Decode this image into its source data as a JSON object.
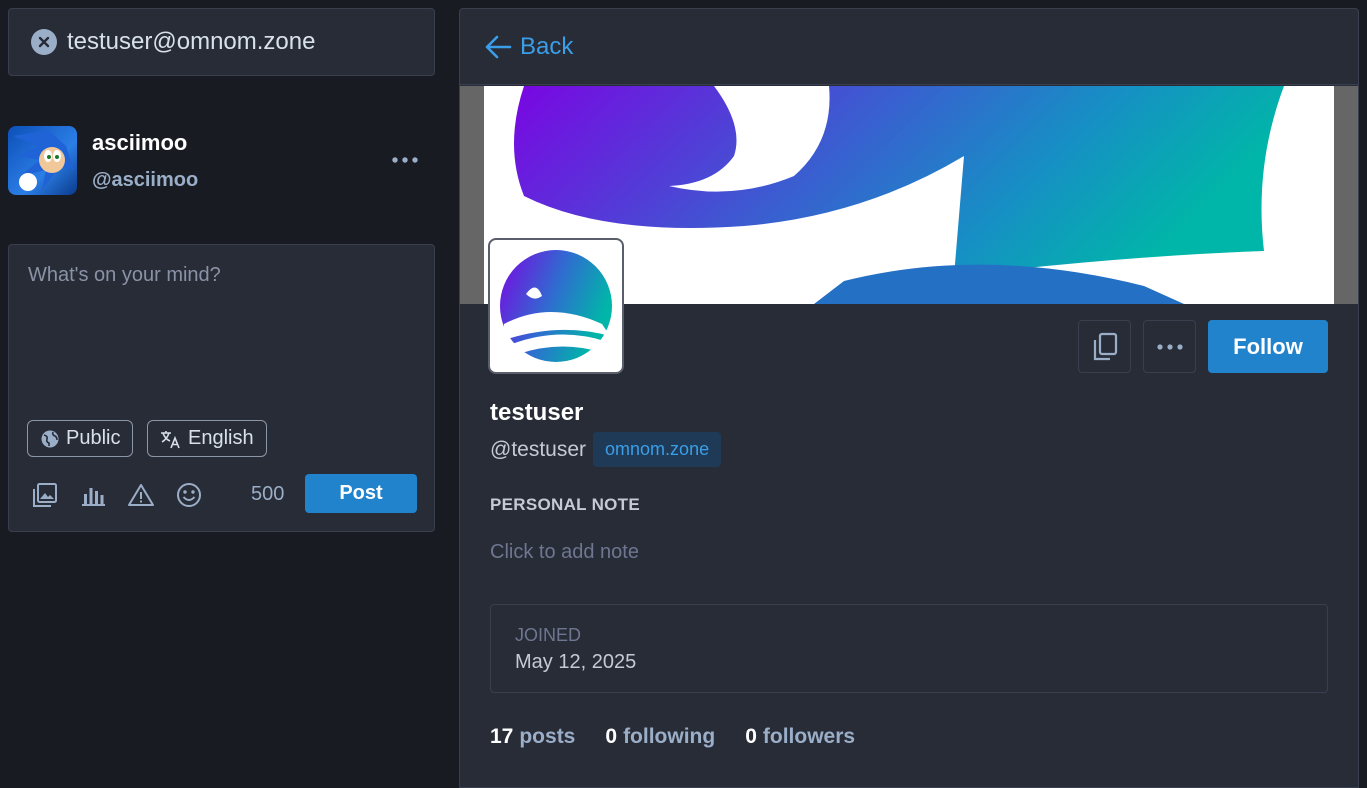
{
  "search": {
    "value": "testuser@omnom.zone"
  },
  "current_account": {
    "display_name": "asciimoo",
    "handle": "@asciimoo"
  },
  "compose": {
    "placeholder": "What's on your mind?",
    "visibility": "Public",
    "language": "English",
    "char_count": "500",
    "post_label": "Post"
  },
  "profile_nav": {
    "back_label": "Back"
  },
  "profile": {
    "display_name": "testuser",
    "handle": "@testuser",
    "domain": "omnom.zone",
    "follow_label": "Follow",
    "note_label": "PERSONAL NOTE",
    "note_placeholder": "Click to add note",
    "joined_label": "JOINED",
    "joined_date": "May 12, 2025",
    "stats": {
      "posts_count": "17",
      "posts_label": "posts",
      "following_count": "0",
      "following_label": "following",
      "followers_count": "0",
      "followers_label": "followers"
    }
  },
  "icons": {
    "search_clear": "close-circle-icon",
    "account_menu": "ellipsis-icon",
    "visibility": "globe-icon",
    "language": "translate-icon",
    "tools": [
      "image-icon",
      "poll-icon",
      "warning-icon",
      "emoji-icon"
    ],
    "back": "arrow-left-icon",
    "copy": "copy-icon",
    "more": "ellipsis-icon"
  },
  "colors": {
    "accent": "#2283cd",
    "link": "#3a9ee8",
    "background": "#191b22",
    "panel": "#282c37"
  }
}
